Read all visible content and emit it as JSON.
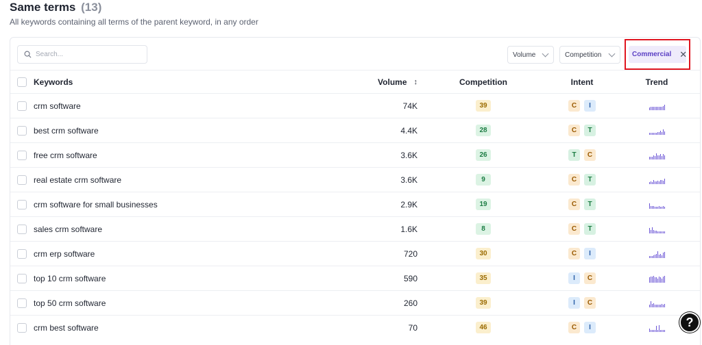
{
  "header": {
    "title": "Same terms",
    "count": "(13)",
    "subtitle": "All keywords containing all terms of the parent keyword, in any order"
  },
  "toolbar": {
    "search_placeholder": "Search...",
    "volume_label": "Volume",
    "competition_label": "Competition",
    "active_filter": "Commercial"
  },
  "columns": {
    "keywords": "Keywords",
    "volume": "Volume",
    "competition": "Competition",
    "intent": "Intent",
    "trend": "Trend"
  },
  "rows": [
    {
      "keyword": "crm software",
      "volume": "74K",
      "competition": "39",
      "competition_level": "medium",
      "intent": [
        "C",
        "I"
      ],
      "trend": [
        3,
        4,
        4,
        4,
        4,
        4,
        4,
        4,
        4,
        4,
        5,
        6
      ]
    },
    {
      "keyword": "best crm software",
      "volume": "4.4K",
      "competition": "28",
      "competition_level": "low",
      "intent": [
        "C",
        "T"
      ],
      "trend": [
        2,
        2,
        2,
        2,
        2,
        2,
        3,
        3,
        5,
        3,
        6,
        4
      ]
    },
    {
      "keyword": "free crm software",
      "volume": "3.6K",
      "competition": "26",
      "competition_level": "low",
      "intent": [
        "T",
        "C"
      ],
      "trend": [
        3,
        3,
        3,
        5,
        4,
        7,
        5,
        5,
        6,
        4,
        6,
        5
      ]
    },
    {
      "keyword": "real estate crm software",
      "volume": "3.6K",
      "competition": "9",
      "competition_level": "low",
      "intent": [
        "C",
        "T"
      ],
      "trend": [
        2,
        3,
        2,
        5,
        3,
        3,
        4,
        3,
        5,
        5,
        4,
        6
      ]
    },
    {
      "keyword": "crm software for small businesses",
      "volume": "2.9K",
      "competition": "19",
      "competition_level": "low",
      "intent": [
        "C",
        "T"
      ],
      "trend": [
        6,
        3,
        3,
        3,
        2,
        2,
        2,
        3,
        2,
        2,
        3,
        2
      ]
    },
    {
      "keyword": "sales crm software",
      "volume": "1.6K",
      "competition": "8",
      "competition_level": "low",
      "intent": [
        "C",
        "T"
      ],
      "trend": [
        6,
        4,
        7,
        4,
        3,
        3,
        2,
        2,
        2,
        2,
        2,
        2
      ]
    },
    {
      "keyword": "crm erp software",
      "volume": "720",
      "competition": "30",
      "competition_level": "medium",
      "intent": [
        "C",
        "I"
      ],
      "trend": [
        2,
        2,
        2,
        3,
        4,
        5,
        8,
        4,
        5,
        3,
        6,
        7
      ]
    },
    {
      "keyword": "top 10 crm software",
      "volume": "590",
      "competition": "35",
      "competition_level": "medium",
      "intent": [
        "I",
        "C"
      ],
      "trend": [
        6,
        7,
        7,
        8,
        6,
        6,
        5,
        7,
        6,
        5,
        7,
        8
      ]
    },
    {
      "keyword": "top 50 crm software",
      "volume": "260",
      "competition": "39",
      "competition_level": "medium",
      "intent": [
        "I",
        "C"
      ],
      "trend": [
        3,
        7,
        4,
        5,
        3,
        3,
        3,
        3,
        3,
        4,
        3,
        4
      ]
    },
    {
      "keyword": "crm best software",
      "volume": "70",
      "competition": "46",
      "competition_level": "medium",
      "intent": [
        "C",
        "I"
      ],
      "trend": [
        4,
        2,
        2,
        2,
        2,
        7,
        2,
        8,
        2,
        2,
        2,
        2
      ]
    }
  ],
  "help_label": "?",
  "colors": {
    "accent": "#5b3fc4",
    "highlight_border": "#e0141f",
    "badge_medium_bg": "#fbefcd",
    "badge_low_bg": "#dcf3e4"
  }
}
